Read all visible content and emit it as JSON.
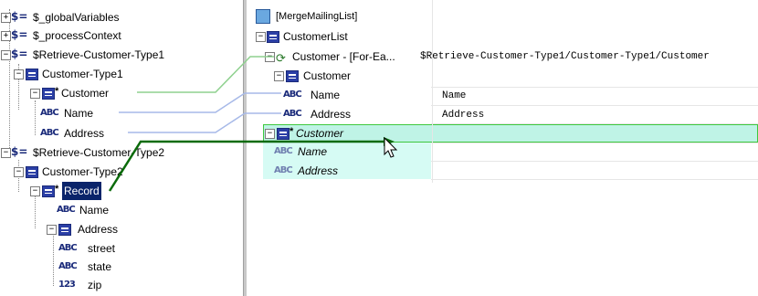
{
  "source_tree": {
    "items": [
      {
        "label": "$_globalVariables"
      },
      {
        "label": "$_processContext"
      },
      {
        "label": "$Retrieve-Customer-Type1"
      },
      {
        "label": "Customer-Type1"
      },
      {
        "label": "Customer"
      },
      {
        "label": "Name"
      },
      {
        "label": "Address"
      },
      {
        "label": "$Retrieve-Customer-Type2"
      },
      {
        "label": "Customer-Type2"
      },
      {
        "label": "Record"
      },
      {
        "label": "Name"
      },
      {
        "label": "Address"
      },
      {
        "label": "street"
      },
      {
        "label": "state"
      },
      {
        "label": "zip"
      }
    ]
  },
  "target_tree": {
    "items": [
      {
        "label": "[MergeMailingList]"
      },
      {
        "label": "CustomerList"
      },
      {
        "label": "Customer - [For-Ea..."
      },
      {
        "label": "Customer"
      },
      {
        "label": "Name"
      },
      {
        "label": "Address"
      },
      {
        "label": "Customer"
      },
      {
        "label": "Name"
      },
      {
        "label": "Address"
      }
    ]
  },
  "expressions": {
    "foreach": "$Retrieve-Customer-Type1/Customer-Type1/Customer",
    "name": "Name",
    "address": "Address"
  },
  "icons": {
    "expand": "+",
    "collapse": "−",
    "variable": "$=",
    "string_type": "ABC",
    "number_type": "123",
    "required": "*"
  },
  "colors": {
    "selection": "#0a246a",
    "mapping_line": "#8fd18f",
    "mapping_line_blue": "#a7b9e8",
    "drag_line": "#0b6b0b",
    "highlight_row": "#bff3e6"
  }
}
